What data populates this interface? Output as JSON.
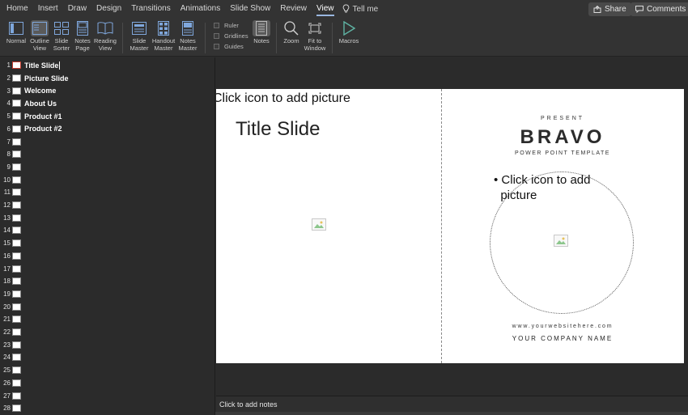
{
  "ribbon_tabs": [
    "Home",
    "Insert",
    "Draw",
    "Design",
    "Transitions",
    "Animations",
    "Slide Show",
    "Review",
    "View"
  ],
  "active_tab": "View",
  "tell_me": "Tell me",
  "share_label": "Share",
  "comments_label": "Comments",
  "view_buttons": {
    "normal": "Normal",
    "outline_view": "Outline\nView",
    "slide_sorter": "Slide\nSorter",
    "notes_page": "Notes\nPage",
    "reading_view": "Reading\nView",
    "slide_master": "Slide\nMaster",
    "handout_master": "Handout\nMaster",
    "notes_master": "Notes\nMaster",
    "notes": "Notes",
    "zoom": "Zoom",
    "fit_to_window": "Fit to\nWindow",
    "macros": "Macros"
  },
  "show_checks": {
    "ruler": "Ruler",
    "gridlines": "Gridlines",
    "guides": "Guides"
  },
  "outline": {
    "titled": [
      "Title Slide",
      "Picture Slide",
      "Welcome",
      "About Us",
      "Product #1",
      "Product #2"
    ],
    "numbers": [
      "1",
      "2",
      "3",
      "4",
      "5",
      "6",
      "7",
      "8",
      "9",
      "10",
      "11",
      "12",
      "13",
      "14",
      "15",
      "16",
      "17",
      "18",
      "19",
      "20",
      "21",
      "22",
      "23",
      "24",
      "25",
      "26",
      "27",
      "28"
    ]
  },
  "slide": {
    "left_placeholder": "Click icon to add picture",
    "title": "Title Slide",
    "present": "PRESENT",
    "brand": "BRAVO",
    "subtitle": "POWER POINT TEMPLATE",
    "bullet_placeholder": "• Click icon to add\n  picture",
    "website": "www.yourwebsitehere.com",
    "company": "YOUR COMPANY NAME"
  },
  "notes_placeholder": "Click to add notes",
  "colors": {
    "selected_slide_border": "#c0392b",
    "accent_underline": "#9ab7e0"
  }
}
